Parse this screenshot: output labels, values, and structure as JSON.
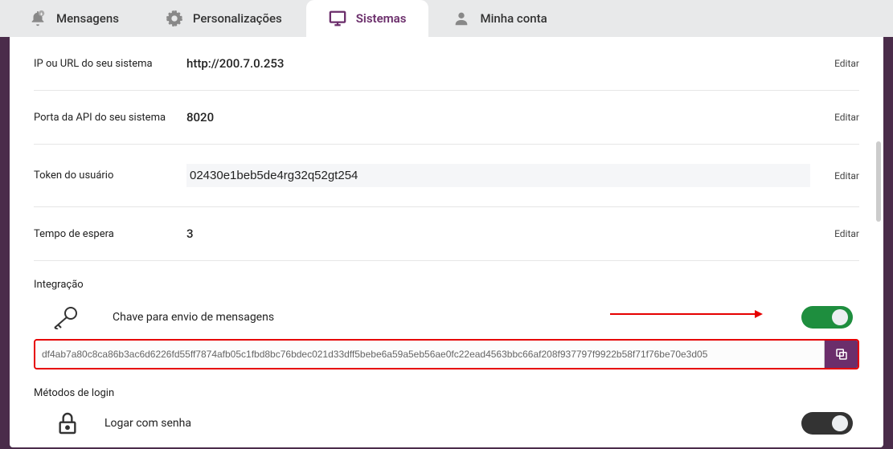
{
  "tabs": {
    "messages": "Mensagens",
    "custom": "Personalizações",
    "systems": "Sistemas",
    "account": "Minha conta"
  },
  "fields": {
    "ip": {
      "label": "IP ou URL do seu sistema",
      "value": "http://200.7.0.253",
      "edit": "Editar"
    },
    "port": {
      "label": "Porta da API do seu sistema",
      "value": "8020",
      "edit": "Editar"
    },
    "token": {
      "label": "Token do usuário",
      "value": "02430e1beb5de4rg32q52gt254",
      "edit": "Editar"
    },
    "wait": {
      "label": "Tempo de espera",
      "value": "3",
      "edit": "Editar"
    }
  },
  "integration": {
    "header": "Integração",
    "label": "Chave para envio de mensagens",
    "api_key": "df4ab7a80c8ca86b3ac6d6226fd55ff7874afb05c1fbd8bc76bdec021d33dff5bebe6a59a5eb56ae0fc22ead4563bbc66af208f937797f9922b58f71f76be70e3d05"
  },
  "login": {
    "header": "Métodos de login",
    "label": "Logar com senha"
  }
}
